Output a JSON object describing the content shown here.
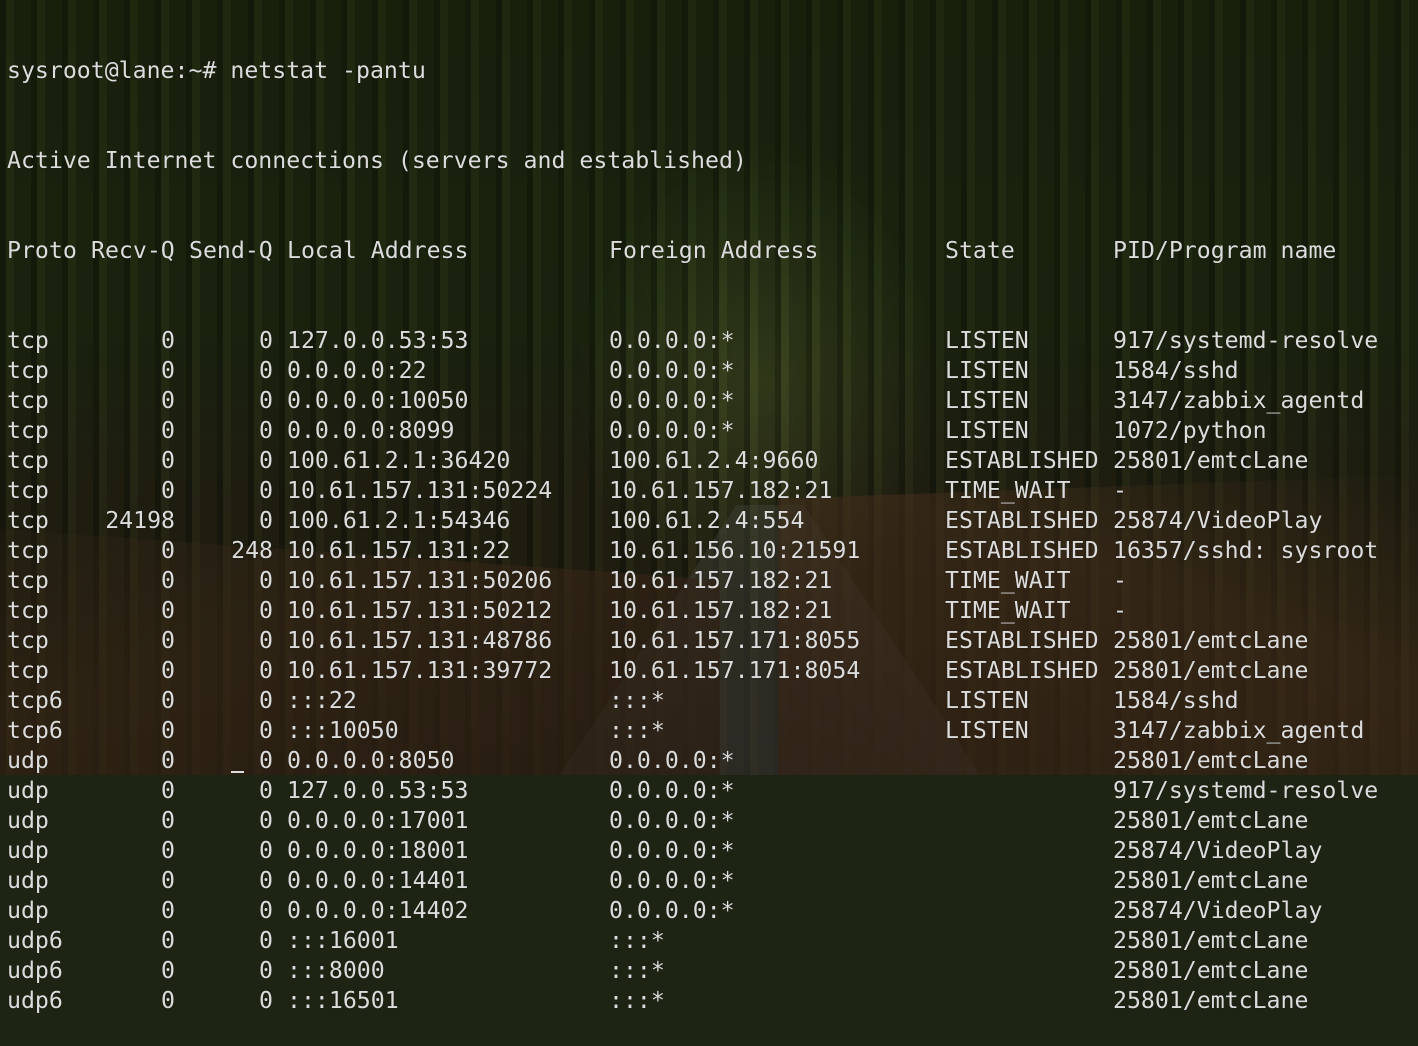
{
  "terminal": {
    "prompt": "sysroot@lane:~#",
    "command": "netstat -pantu",
    "title_line": "Active Internet connections (servers and established)",
    "headers": {
      "proto": "Proto",
      "recvq": "Recv-Q",
      "sendq": "Send-Q",
      "local": "Local Address",
      "foreign": "Foreign Address",
      "state": "State",
      "pid": "PID/Program name"
    },
    "rows": [
      {
        "proto": "tcp",
        "recvq": "0",
        "sendq": "0",
        "local": "127.0.0.53:53",
        "foreign": "0.0.0.0:*",
        "state": "LISTEN",
        "pid": "917/systemd-resolve"
      },
      {
        "proto": "tcp",
        "recvq": "0",
        "sendq": "0",
        "local": "0.0.0.0:22",
        "foreign": "0.0.0.0:*",
        "state": "LISTEN",
        "pid": "1584/sshd"
      },
      {
        "proto": "tcp",
        "recvq": "0",
        "sendq": "0",
        "local": "0.0.0.0:10050",
        "foreign": "0.0.0.0:*",
        "state": "LISTEN",
        "pid": "3147/zabbix_agentd"
      },
      {
        "proto": "tcp",
        "recvq": "0",
        "sendq": "0",
        "local": "0.0.0.0:8099",
        "foreign": "0.0.0.0:*",
        "state": "LISTEN",
        "pid": "1072/python"
      },
      {
        "proto": "tcp",
        "recvq": "0",
        "sendq": "0",
        "local": "100.61.2.1:36420",
        "foreign": "100.61.2.4:9660",
        "state": "ESTABLISHED",
        "pid": "25801/emtcLane"
      },
      {
        "proto": "tcp",
        "recvq": "0",
        "sendq": "0",
        "local": "10.61.157.131:50224",
        "foreign": "10.61.157.182:21",
        "state": "TIME_WAIT",
        "pid": "-"
      },
      {
        "proto": "tcp",
        "recvq": "24198",
        "sendq": "0",
        "local": "100.61.2.1:54346",
        "foreign": "100.61.2.4:554",
        "state": "ESTABLISHED",
        "pid": "25874/VideoPlay"
      },
      {
        "proto": "tcp",
        "recvq": "0",
        "sendq": "248",
        "local": "10.61.157.131:22",
        "foreign": "10.61.156.10:21591",
        "state": "ESTABLISHED",
        "pid": "16357/sshd: sysroot"
      },
      {
        "proto": "tcp",
        "recvq": "0",
        "sendq": "0",
        "local": "10.61.157.131:50206",
        "foreign": "10.61.157.182:21",
        "state": "TIME_WAIT",
        "pid": "-"
      },
      {
        "proto": "tcp",
        "recvq": "0",
        "sendq": "0",
        "local": "10.61.157.131:50212",
        "foreign": "10.61.157.182:21",
        "state": "TIME_WAIT",
        "pid": "-"
      },
      {
        "proto": "tcp",
        "recvq": "0",
        "sendq": "0",
        "local": "10.61.157.131:48786",
        "foreign": "10.61.157.171:8055",
        "state": "ESTABLISHED",
        "pid": "25801/emtcLane"
      },
      {
        "proto": "tcp",
        "recvq": "0",
        "sendq": "0",
        "local": "10.61.157.131:39772",
        "foreign": "10.61.157.171:8054",
        "state": "ESTABLISHED",
        "pid": "25801/emtcLane"
      },
      {
        "proto": "tcp6",
        "recvq": "0",
        "sendq": "0",
        "local": ":::22",
        "foreign": ":::*",
        "state": "LISTEN",
        "pid": "1584/sshd"
      },
      {
        "proto": "tcp6",
        "recvq": "0",
        "sendq": "0",
        "local": ":::10050",
        "foreign": ":::*",
        "state": "LISTEN",
        "pid": "3147/zabbix_agentd"
      },
      {
        "proto": "udp",
        "recvq": "0",
        "sendq": "0",
        "local": "0.0.0.0:8050",
        "foreign": "0.0.0.0:*",
        "state": "",
        "pid": "25801/emtcLane"
      },
      {
        "proto": "udp",
        "recvq": "0",
        "sendq": "0",
        "local": "127.0.0.53:53",
        "foreign": "0.0.0.0:*",
        "state": "",
        "pid": "917/systemd-resolve"
      },
      {
        "proto": "udp",
        "recvq": "0",
        "sendq": "0",
        "local": "0.0.0.0:17001",
        "foreign": "0.0.0.0:*",
        "state": "",
        "pid": "25801/emtcLane"
      },
      {
        "proto": "udp",
        "recvq": "0",
        "sendq": "0",
        "local": "0.0.0.0:18001",
        "foreign": "0.0.0.0:*",
        "state": "",
        "pid": "25874/VideoPlay"
      },
      {
        "proto": "udp",
        "recvq": "0",
        "sendq": "0",
        "local": "0.0.0.0:14401",
        "foreign": "0.0.0.0:*",
        "state": "",
        "pid": "25801/emtcLane"
      },
      {
        "proto": "udp",
        "recvq": "0",
        "sendq": "0",
        "local": "0.0.0.0:14402",
        "foreign": "0.0.0.0:*",
        "state": "",
        "pid": "25874/VideoPlay"
      },
      {
        "proto": "udp6",
        "recvq": "0",
        "sendq": "0",
        "local": ":::16001",
        "foreign": ":::*",
        "state": "",
        "pid": "25801/emtcLane"
      },
      {
        "proto": "udp6",
        "recvq": "0",
        "sendq": "0",
        "local": ":::8000",
        "foreign": ":::*",
        "state": "",
        "pid": "25801/emtcLane"
      },
      {
        "proto": "udp6",
        "recvq": "0",
        "sendq": "0",
        "local": ":::16501",
        "foreign": ":::*",
        "state": "",
        "pid": "25801/emtcLane"
      }
    ]
  },
  "colors": {
    "text": "#dcdcdc"
  }
}
